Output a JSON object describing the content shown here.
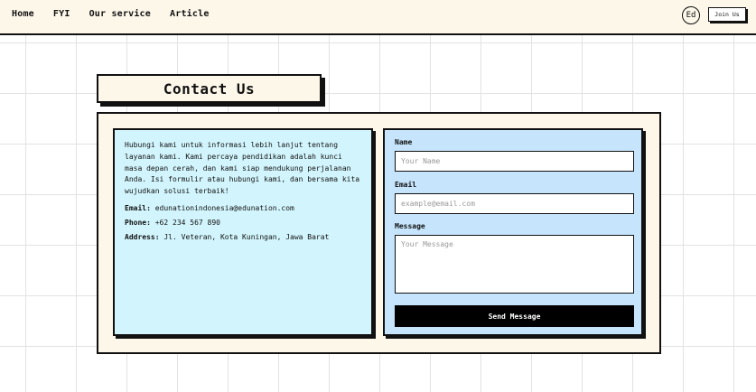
{
  "nav": {
    "links": [
      "Home",
      "FYI",
      "Our service",
      "Article"
    ],
    "avatar": "Ed",
    "join_label": "Join Us"
  },
  "page": {
    "title": "Contact Us"
  },
  "info": {
    "description": "Hubungi kami untuk informasi lebih lanjut tentang layanan kami. Kami percaya pendidikan adalah kunci masa depan cerah, dan kami siap mendukung perjalanan Anda. Isi formulir atau hubungi kami, dan bersama kita wujudkan solusi terbaik!",
    "email_label": "Email:",
    "email_value": "edunationindonesia@edunation.com",
    "phone_label": "Phone:",
    "phone_value": "+62 234 567 890",
    "address_label": "Address:",
    "address_value": "Jl. Veteran, Kota Kuningan, Jawa Barat"
  },
  "form": {
    "name_label": "Name",
    "name_placeholder": "Your Name",
    "email_label": "Email",
    "email_placeholder": "example@email.com",
    "message_label": "Message",
    "message_placeholder": "Your Message",
    "submit_label": "Send Message"
  },
  "colors": {
    "navbar_bg": "#fdf7ea",
    "info_card_bg": "#d2f5fd",
    "form_card_bg": "#c6e5fc",
    "button_bg": "#000000"
  }
}
